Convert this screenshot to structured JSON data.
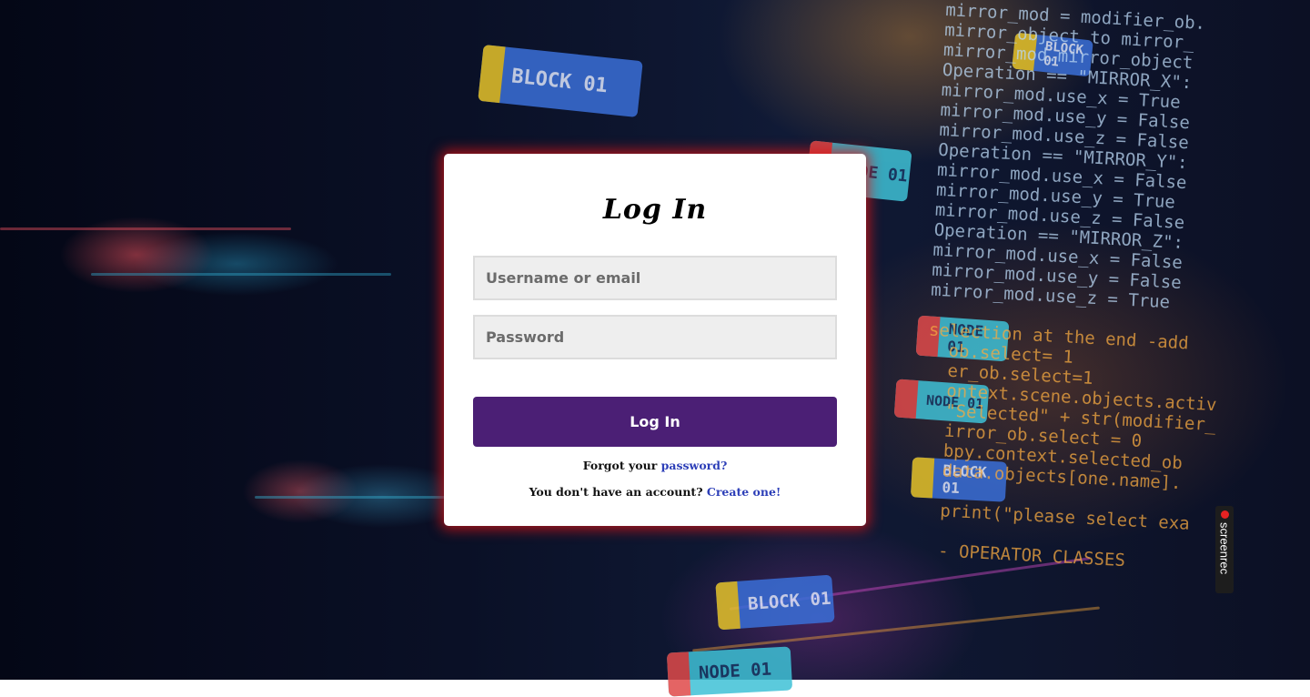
{
  "background": {
    "nodes": [
      "BLOCK 01",
      "NODE 01",
      "NODE 01",
      "NODE 01",
      "BLOCK 01",
      "BLOCK 01",
      "NODE 01",
      "BLOCK 01"
    ],
    "code_lines": [
      "mirror_mod = modifier_ob.",
      "mirror_object to mirror_",
      "mirror_mod.mirror_object",
      "Operation == \"MIRROR_X\":",
      "mirror_mod.use_x = True",
      "mirror_mod.use_y = False",
      "mirror_mod.use_z = False",
      "Operation == \"MIRROR_Y\":",
      "mirror_mod.use_x = False",
      "mirror_mod.use_y = True",
      "mirror_mod.use_z = False",
      "Operation == \"MIRROR_Z\":",
      "mirror_mod.use_x = False",
      "mirror_mod.use_y = False",
      "mirror_mod.use_z = True",
      "",
      "selection at the end -add",
      "  ob.select= 1",
      "  er_ob.select=1",
      "  ontext.scene.objects.activ",
      "  \"Selected\" + str(modifier_",
      "  irror_ob.select = 0",
      "  bpy.context.selected_ob",
      "  data.objects[one.name].",
      "",
      "  print(\"please select exa",
      "",
      "  - OPERATOR CLASSES"
    ]
  },
  "recorder": {
    "label": "screenrec"
  },
  "login": {
    "title": "Log In",
    "username_placeholder": "Username or email",
    "password_placeholder": "Password",
    "submit_label": "Log In",
    "forgot_text": "Forgot your",
    "forgot_link": "password?",
    "create_text": "You don't have an account?",
    "create_link": "Create one!"
  },
  "colors": {
    "button": "#4b1f75",
    "link": "#2d3fb8",
    "card_glow": "#dc1414"
  }
}
